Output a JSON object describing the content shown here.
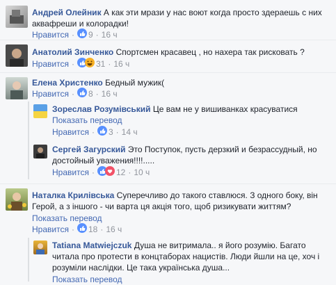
{
  "comments": [
    {
      "author": "Андрей Олейник",
      "text": "А как эти мрази у нас воют когда просто здераешь с них аквафреши и колорадки!",
      "like_label": "Нравится",
      "reactions_count": "9",
      "time": "16 ч"
    },
    {
      "author": "Анатолий Зинченко",
      "text": "Спортсмен красавец , но нахера так рисковать ?",
      "like_label": "Нравится",
      "reactions_count": "31",
      "time": "16 ч"
    },
    {
      "author": "Елена Христенко",
      "text": "Бедный мужик(",
      "like_label": "Нравится",
      "reactions_count": "8",
      "time": "16 ч"
    },
    {
      "author": "Зореслав Розумівський",
      "text": "Це вам не у вишиванках красуватися",
      "translate_label": "Показать перевод",
      "like_label": "Нравится",
      "reactions_count": "3",
      "time": "14 ч"
    },
    {
      "author": "Сергей Загурский",
      "text": "Это Поступок, пусть дерзкий и безрассудный, но достойный уважения!!!!.....",
      "like_label": "Нравится",
      "reactions_count": "12",
      "time": "10 ч"
    },
    {
      "author": "Наталка Крилівська",
      "text": "Суперечливо до такого ставлюся. З одного боку, він Герой, а з іншого - чи варта ця акція того, щоб ризикувати життям?",
      "translate_label": "Показать перевод",
      "like_label": "Нравится",
      "reactions_count": "18",
      "time": "16 ч"
    },
    {
      "author": "Tatiana Matwiejczuk",
      "text": "Душа не витримала.. я його розумію. Багато читала про протести в концтаборах нацистів. Люди йшли на це, хоч і розуміли наслідки. Це така українська душа...",
      "translate_label": "Показать перевод"
    }
  ],
  "colors": {
    "author": "#365899",
    "link": "#4267b2",
    "meta": "#90949c",
    "like_blue": "#5890ff",
    "love_red": "#f25268",
    "haha_yellow": "#f7b125"
  }
}
